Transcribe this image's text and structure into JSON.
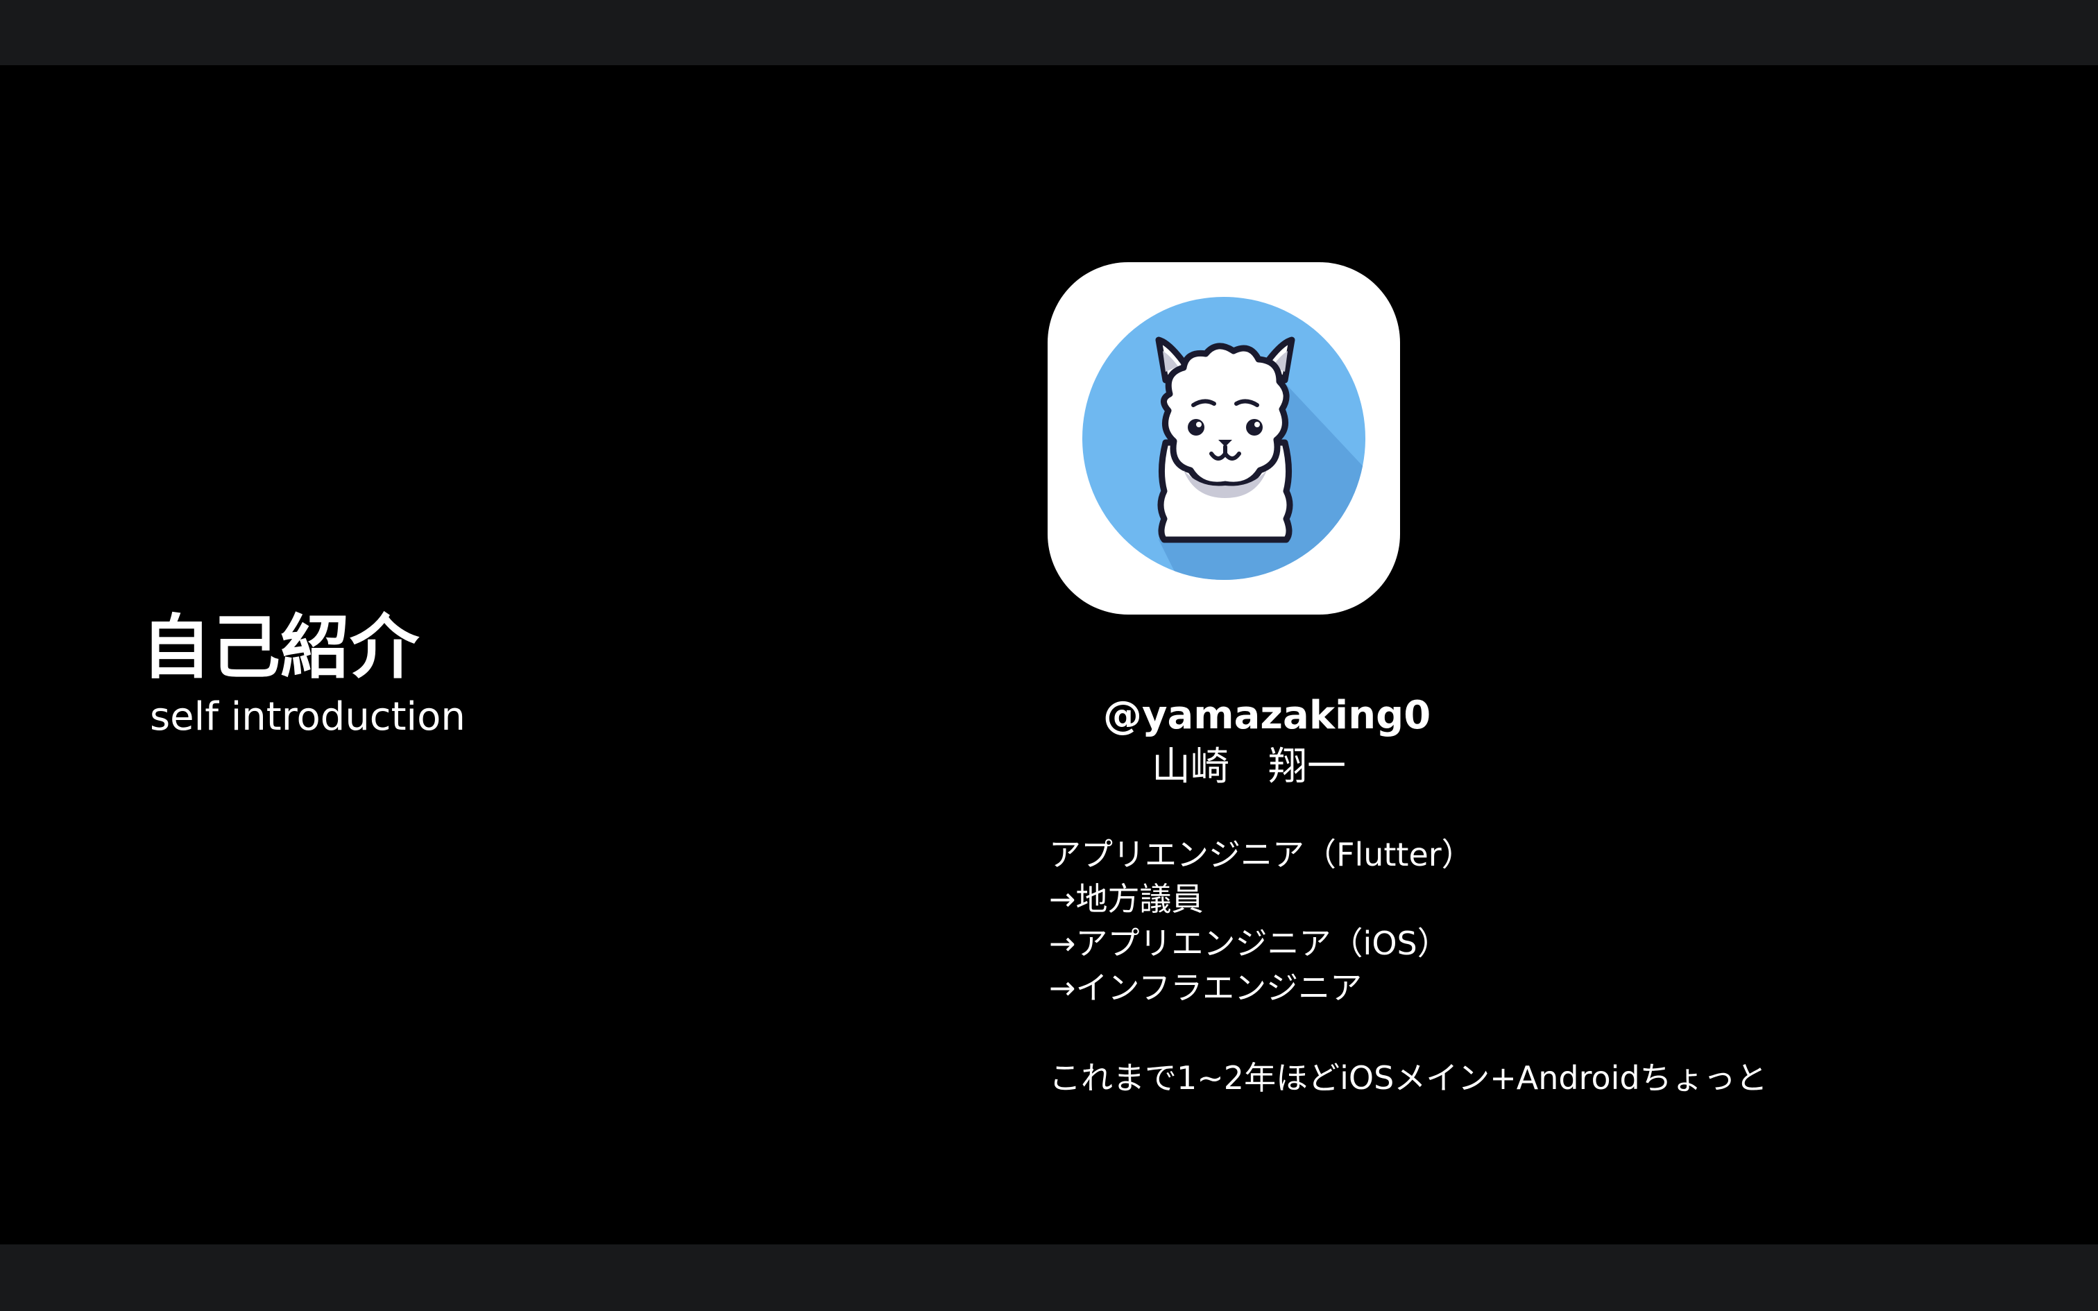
{
  "slide": {
    "title": "自己紹介",
    "subtitle": "self introduction"
  },
  "profile": {
    "avatar_icon": "alpaca-icon",
    "handle": "@yamazaking0",
    "name": "山崎　翔一",
    "career": [
      "アプリエンジニア（Flutter）",
      "→地方議員",
      "→アプリエンジニア（iOS）",
      "→インフラエンジニア"
    ],
    "experience": "これまで1~2年ほどiOSメイン+Androidちょっと"
  },
  "colors": {
    "background": "#000000",
    "chrome": "#18191b",
    "text": "#ffffff",
    "avatar_circle": "#6fb8f0",
    "avatar_shadow": "#5a9fdc",
    "alpaca_outline": "#1a1a2e"
  }
}
